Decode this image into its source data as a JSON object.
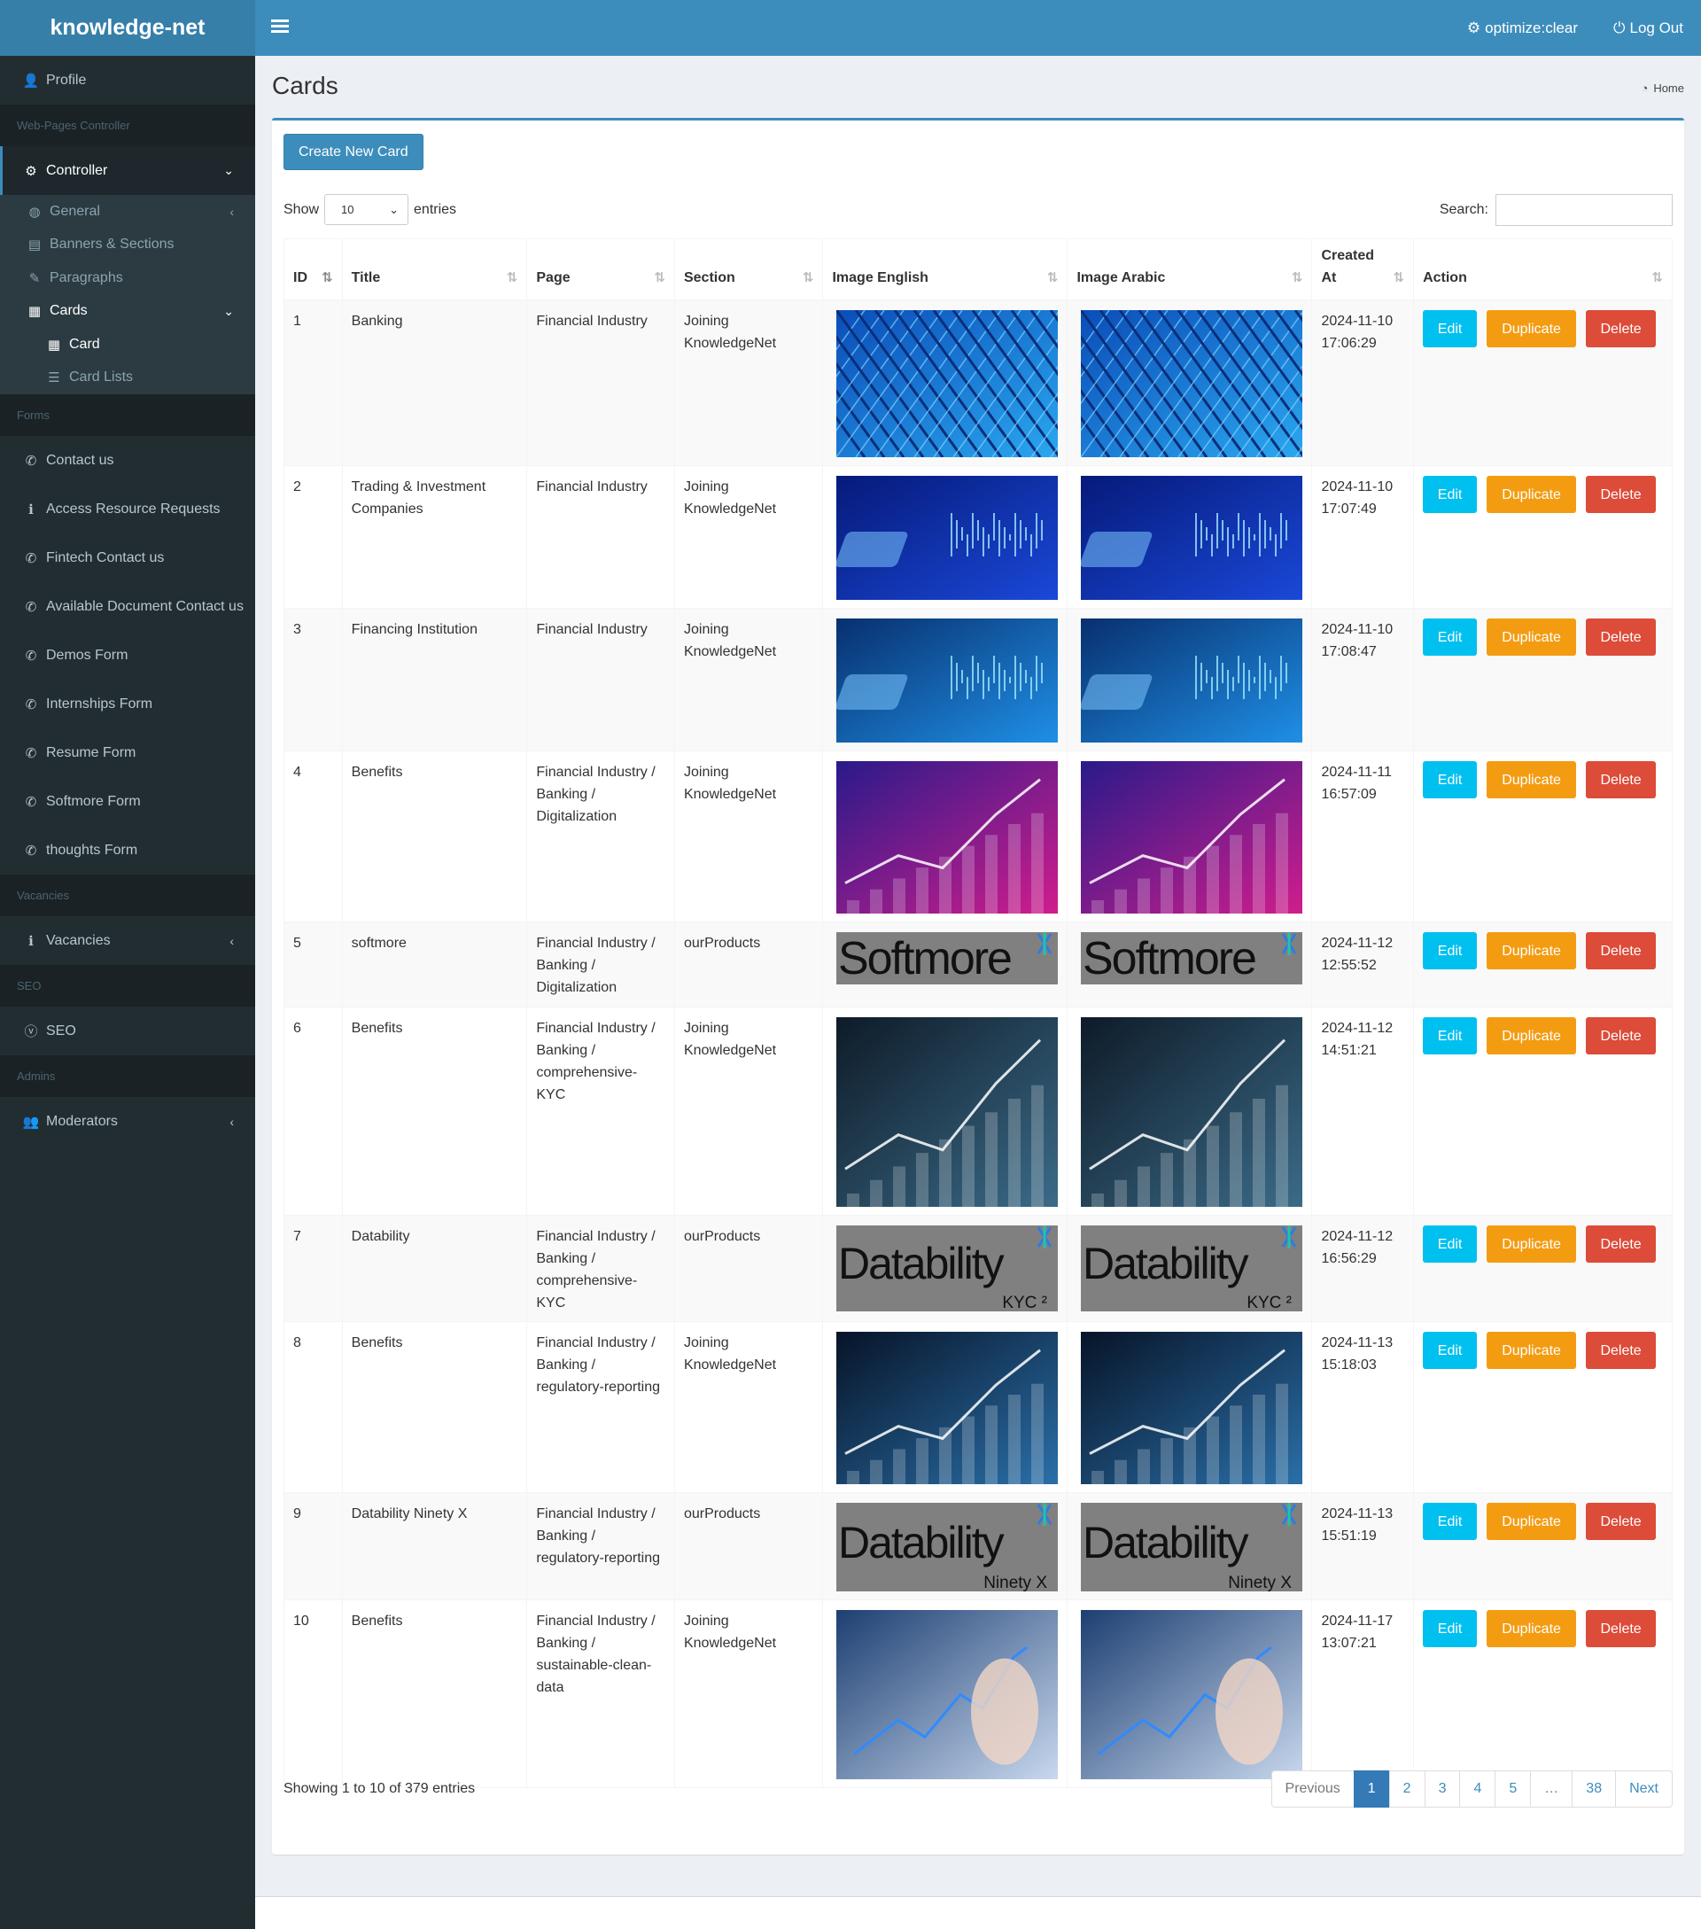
{
  "app": {
    "name": "knowledge-net"
  },
  "topbar": {
    "optimize_label": "optimize:clear",
    "logout_label": "Log Out"
  },
  "sidebar": {
    "profile": "Profile",
    "h_webpages": "Web-Pages Controller",
    "controller": "Controller",
    "general": "General",
    "banners": "Banners & Sections",
    "paragraphs": "Paragraphs",
    "cards": "Cards",
    "card": "Card",
    "card_lists": "Card Lists",
    "h_forms": "Forms",
    "forms": [
      "Contact us",
      "Access Resource Requests",
      "Fintech Contact us",
      "Available Document Contact us",
      "Demos Form",
      "Internships Form",
      "Resume Form",
      "Softmore Form",
      "thoughts Form"
    ],
    "h_vacancies": "Vacancies",
    "vacancies": "Vacancies",
    "h_seo": "SEO",
    "seo": "SEO",
    "h_admins": "Admins",
    "moderators": "Moderators"
  },
  "page": {
    "title": "Cards",
    "breadcrumb": "Home"
  },
  "toolbar": {
    "create_label": "Create New Card",
    "show": "Show",
    "entries_value": "10",
    "entries": "entries",
    "search": "Search:"
  },
  "table": {
    "headers": {
      "id": "ID",
      "title": "Title",
      "page": "Page",
      "section": "Section",
      "img_en": "Image English",
      "img_ar": "Image Arabic",
      "created_1": "Created",
      "created_2": "At",
      "action": "Action"
    },
    "btn": {
      "edit": "Edit",
      "duplicate": "Duplicate",
      "delete": "Delete"
    },
    "rows": [
      {
        "id": "1",
        "title": "Banking",
        "page": "Financial Industry",
        "section": "Joining KnowledgeNet",
        "image": "blue-geometric-building",
        "date": "2024-11-10",
        "time": "17:06:29"
      },
      {
        "id": "2",
        "title": "Trading & Investment Companies",
        "page": "Financial Industry",
        "section": "Joining KnowledgeNet",
        "image": "phone-trading-chart",
        "date": "2024-11-10",
        "time": "17:07:49"
      },
      {
        "id": "3",
        "title": "Financing Institution",
        "page": "Financial Industry",
        "section": "Joining KnowledgeNet",
        "image": "hands-on-data-screen",
        "date": "2024-11-10",
        "time": "17:08:47"
      },
      {
        "id": "4",
        "title": "Benefits",
        "page": "Financial Industry / Banking / Digitalization",
        "section": "Joining KnowledgeNet",
        "image": "hand-rising-bar-chart",
        "date": "2024-11-11",
        "time": "16:57:09"
      },
      {
        "id": "5",
        "title": "softmore",
        "page": "Financial Industry / Banking / Digitalization",
        "section": "ourProducts",
        "image": "softmore-logo",
        "logo_text": "Softmore",
        "logo_sub": "",
        "date": "2024-11-12",
        "time": "12:55:52"
      },
      {
        "id": "6",
        "title": "Benefits",
        "page": "Financial Industry / Banking / comprehensive-KYC",
        "section": "Joining KnowledgeNet",
        "image": "finance-dashboard-touch",
        "date": "2024-11-12",
        "time": "14:51:21"
      },
      {
        "id": "7",
        "title": "Datability",
        "page": "Financial Industry / Banking / comprehensive-KYC",
        "section": "ourProducts",
        "image": "datability-kyc-logo",
        "logo_text": "Datability",
        "logo_sub": "KYC ²",
        "date": "2024-11-12",
        "time": "16:56:29"
      },
      {
        "id": "8",
        "title": "Benefits",
        "page": "Financial Industry / Banking / regulatory-reporting",
        "section": "Joining KnowledgeNet",
        "image": "tablet-analytics",
        "date": "2024-11-13",
        "time": "15:18:03"
      },
      {
        "id": "9",
        "title": "Datability Ninety X",
        "page": "Financial Industry / Banking / regulatory-reporting",
        "section": "ourProducts",
        "image": "datability-ninetyx-logo",
        "logo_text": "Datability",
        "logo_sub": "Ninety X",
        "date": "2024-11-13",
        "time": "15:51:19"
      },
      {
        "id": "10",
        "title": "Benefits",
        "page": "Financial Industry / Banking / sustainable-clean-data",
        "section": "Joining KnowledgeNet",
        "image": "finger-rising-arrow",
        "date": "2024-11-17",
        "time": "13:07:21"
      }
    ]
  },
  "footer": {
    "info": "Showing 1 to 10 of 379 entries",
    "pages": [
      "Previous",
      "1",
      "2",
      "3",
      "4",
      "5",
      "…",
      "38",
      "Next"
    ],
    "current_page": "1"
  },
  "colors": {
    "primary": "#3c8dbc",
    "sidebar": "#222d32",
    "edit": "#00c0ef",
    "duplicate": "#f39c12",
    "delete": "#dd4b39"
  }
}
